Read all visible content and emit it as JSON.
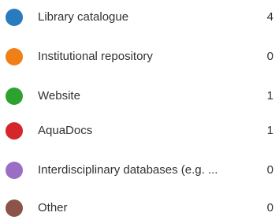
{
  "legend": {
    "items": [
      {
        "label": "Library catalogue",
        "count": "4",
        "color": "#2a7bbd"
      },
      {
        "label": "Institutional repository",
        "count": "0",
        "color": "#f07f18"
      },
      {
        "label": "Website",
        "count": "1",
        "color": "#2ea22f"
      },
      {
        "label": "AquaDocs",
        "count": "1",
        "color": "#d52729"
      },
      {
        "label": "Interdisciplinary databases (e.g. ...",
        "count": "0",
        "color": "#9b6ec6"
      },
      {
        "label": "Other",
        "count": "0",
        "color": "#8b5449"
      }
    ]
  }
}
